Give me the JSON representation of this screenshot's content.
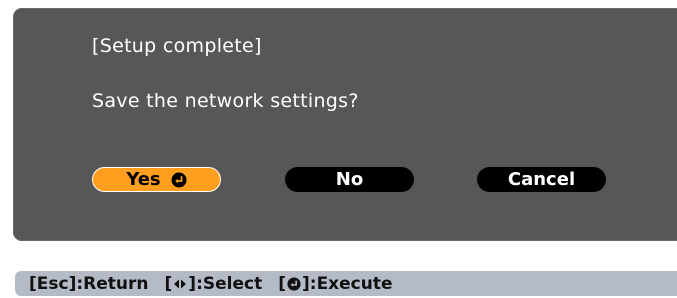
{
  "dialog": {
    "title": "[Setup complete]",
    "message": "Save the network settings?",
    "buttons": {
      "yes": "Yes",
      "yes_icon": "enter-icon",
      "no": "No",
      "cancel": "Cancel"
    },
    "selected_button": "yes"
  },
  "hints": {
    "esc_key": "[Esc]",
    "esc_action": ":Return",
    "select_open": "[",
    "select_icon": "left-right-arrows-icon",
    "select_close": "]",
    "select_action": ":Select",
    "execute_open": "[",
    "execute_icon": "enter-icon",
    "execute_close": "]",
    "execute_action": ":Execute"
  },
  "colors": {
    "dialog_bg": "#575757",
    "selected_button": "#ff9e1f",
    "button_bg": "#000000",
    "hint_bar_bg": "#b4bac6"
  }
}
